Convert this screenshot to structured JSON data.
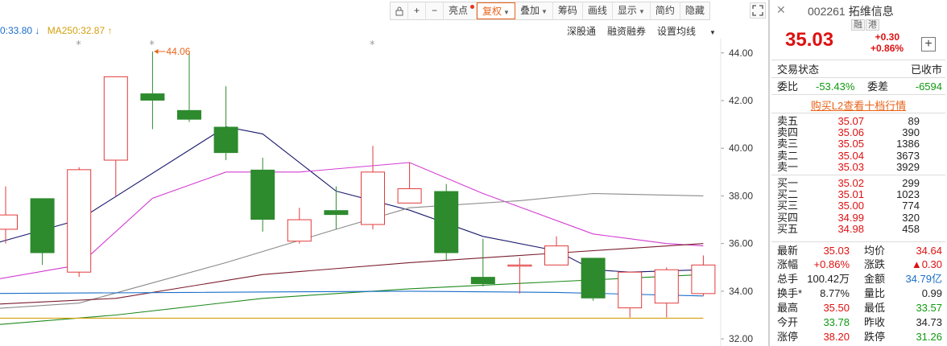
{
  "toolbar": {
    "items": [
      "亮点",
      "复权",
      "叠加",
      "筹码",
      "画线",
      "显示",
      "简约",
      "隐藏"
    ],
    "lock_icon": "lock-icon",
    "zoom_in": "+",
    "zoom_out": "−",
    "expand_icon": "expand-icon"
  },
  "ma_legend": {
    "ma120_text": "0:33.80",
    "ma120_arrow": "↓",
    "ma250_text": "MA250:32.87",
    "ma250_arrow": "↑"
  },
  "chart_menu": {
    "shenguton": "深股通",
    "margin": "融资融券",
    "ma_settings": "设置均线"
  },
  "chart_data": {
    "type": "candlestick",
    "y_axis": {
      "min": 31.7,
      "max": 44.6,
      "ticks": [
        "44.00",
        "42.00",
        "40.00",
        "38.00",
        "36.00",
        "34.00",
        "32.00"
      ]
    },
    "max_annotation": "44.06",
    "marker_symbol": "*",
    "marker_candles": [
      2,
      4,
      10
    ],
    "candles": [
      {
        "o": 36.6,
        "c": 37.2,
        "h": 38.4,
        "l": 36.0
      },
      {
        "o": 37.9,
        "c": 35.6,
        "h": 37.9,
        "l": 35.1
      },
      {
        "o": 34.8,
        "c": 39.1,
        "h": 39.2,
        "l": 34.6
      },
      {
        "o": 39.5,
        "c": 43.0,
        "h": 43.0,
        "l": 38.0
      },
      {
        "o": 42.3,
        "c": 42.0,
        "h": 44.06,
        "l": 40.8
      },
      {
        "o": 41.6,
        "c": 41.2,
        "h": 44.0,
        "l": 41.1
      },
      {
        "o": 40.9,
        "c": 39.8,
        "h": 42.6,
        "l": 39.5
      },
      {
        "o": 39.1,
        "c": 37.0,
        "h": 39.6,
        "l": 36.5
      },
      {
        "o": 36.1,
        "c": 37.0,
        "h": 37.5,
        "l": 36.0
      },
      {
        "o": 37.4,
        "c": 37.2,
        "h": 38.4,
        "l": 36.6
      },
      {
        "o": 36.8,
        "c": 39.0,
        "h": 40.1,
        "l": 36.6
      },
      {
        "o": 37.7,
        "c": 38.3,
        "h": 39.4,
        "l": 37.7
      },
      {
        "o": 38.2,
        "c": 35.6,
        "h": 38.5,
        "l": 35.3
      },
      {
        "o": 34.6,
        "c": 34.3,
        "h": 36.2,
        "l": 34.2
      },
      {
        "o": 35.1,
        "c": 35.1,
        "h": 35.4,
        "l": 33.9
      },
      {
        "o": 35.1,
        "c": 35.9,
        "h": 36.3,
        "l": 35.1
      },
      {
        "o": 35.4,
        "c": 33.7,
        "h": 35.4,
        "l": 33.6
      },
      {
        "o": 33.3,
        "c": 34.8,
        "h": 34.8,
        "l": 32.9
      },
      {
        "o": 33.5,
        "c": 34.9,
        "h": 35.0,
        "l": 32.9
      },
      {
        "o": 33.9,
        "c": 35.1,
        "h": 35.5,
        "l": 33.8
      }
    ],
    "ma_lines": [
      {
        "color": "#1a1a6e",
        "points": [
          [
            -1,
            35.7
          ],
          [
            2,
            37.0
          ],
          [
            6,
            40.9
          ],
          [
            7,
            40.6
          ],
          [
            9,
            38.2
          ],
          [
            11,
            37.4
          ],
          [
            13,
            36.3
          ],
          [
            15,
            35.7
          ],
          [
            16,
            34.9
          ],
          [
            17,
            34.8
          ],
          [
            19,
            34.9
          ]
        ]
      },
      {
        "color": "#d23cd2",
        "points": [
          [
            -1,
            34.3
          ],
          [
            2,
            35.1
          ],
          [
            4,
            37.9
          ],
          [
            6,
            39.0
          ],
          [
            8,
            39.0
          ],
          [
            11,
            39.4
          ],
          [
            13,
            38.1
          ],
          [
            16,
            36.4
          ],
          [
            18,
            36.0
          ],
          [
            19,
            35.9
          ]
        ]
      },
      {
        "color": "#8a8a8a",
        "points": [
          [
            -1,
            33.2
          ],
          [
            2,
            33.5
          ],
          [
            6,
            35.2
          ],
          [
            9,
            36.6
          ],
          [
            11,
            37.5
          ],
          [
            14,
            37.8
          ],
          [
            16,
            38.1
          ],
          [
            19,
            38.0
          ]
        ]
      },
      {
        "color": "#7a1e2e",
        "points": [
          [
            -1,
            33.4
          ],
          [
            3,
            33.7
          ],
          [
            7,
            34.7
          ],
          [
            11,
            35.2
          ],
          [
            15,
            35.6
          ],
          [
            19,
            36.0
          ]
        ]
      },
      {
        "color": "#1f8a1f",
        "points": [
          [
            -1,
            32.5
          ],
          [
            3,
            33.0
          ],
          [
            7,
            33.7
          ],
          [
            11,
            34.1
          ],
          [
            15,
            34.4
          ],
          [
            19,
            34.7
          ]
        ]
      },
      {
        "color": "#1a6ec8",
        "points": [
          [
            -1,
            33.9
          ],
          [
            5,
            33.95
          ],
          [
            11,
            34.0
          ],
          [
            15,
            33.95
          ],
          [
            19,
            33.8
          ]
        ]
      },
      {
        "color": "#d4a010",
        "points": [
          [
            -1,
            32.87
          ],
          [
            19,
            32.87
          ]
        ]
      }
    ]
  },
  "stock": {
    "code": "002261",
    "name": "拓维信息",
    "badge1": "融",
    "badge2": "港",
    "price": "35.03",
    "change": "+0.30",
    "change_pct": "+0.86%",
    "plus": "+"
  },
  "status": {
    "label": "交易状态",
    "value": "已收市",
    "weibi_label": "委比",
    "weibi_value": "-53.43%",
    "weicha_label": "委差",
    "weicha_value": "-6594",
    "l2_link": "购买L2查看十档行情"
  },
  "order_book": {
    "sells": [
      {
        "label": "卖五",
        "price": "35.07",
        "vol": "89"
      },
      {
        "label": "卖四",
        "price": "35.06",
        "vol": "390"
      },
      {
        "label": "卖三",
        "price": "35.05",
        "vol": "1386"
      },
      {
        "label": "卖二",
        "price": "35.04",
        "vol": "3673"
      },
      {
        "label": "卖一",
        "price": "35.03",
        "vol": "3929"
      }
    ],
    "buys": [
      {
        "label": "买一",
        "price": "35.02",
        "vol": "299"
      },
      {
        "label": "买二",
        "price": "35.01",
        "vol": "1023"
      },
      {
        "label": "买三",
        "price": "35.00",
        "vol": "774"
      },
      {
        "label": "买四",
        "price": "34.99",
        "vol": "320"
      },
      {
        "label": "买五",
        "price": "34.98",
        "vol": "458"
      }
    ]
  },
  "stats": {
    "latest_label": "最新",
    "latest": "35.03",
    "avg_label": "均价",
    "avg": "34.64",
    "pct_label": "涨幅",
    "pct": "+0.86%",
    "chg_label": "涨跌",
    "chg": "▲0.30",
    "hand_label": "总手",
    "hand": "100.42万",
    "amount_label": "金额",
    "amount": "34.79亿",
    "turnover_label": "换手*",
    "turnover": "8.77%",
    "vr_label": "量比",
    "vr": "0.99",
    "high_label": "最高",
    "high": "35.50",
    "low_label": "最低",
    "low": "33.57",
    "open_label": "今开",
    "open": "33.78",
    "prev_label": "昨收",
    "prev": "34.73",
    "limitup_label": "涨停",
    "limitup": "38.20",
    "limitdown_label": "跌停",
    "limitdown": "31.26"
  }
}
